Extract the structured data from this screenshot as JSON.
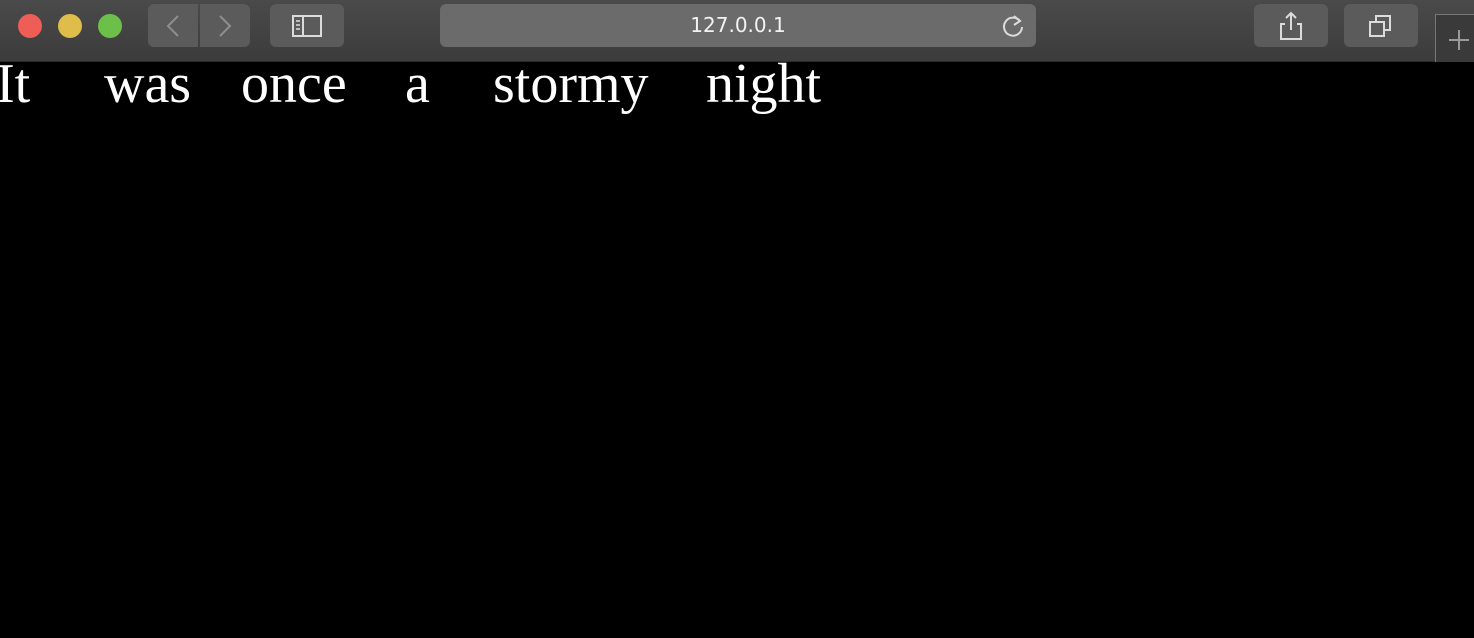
{
  "browser": {
    "address_bar": {
      "url": "127.0.0.1"
    },
    "icons": {
      "back": "chevron-left-icon",
      "forward": "chevron-right-icon",
      "sidebar": "sidebar-icon",
      "reload": "reload-icon",
      "share": "share-icon",
      "tabs": "tabs-overview-icon",
      "new_tab": "plus-icon"
    },
    "colors": {
      "close": "#ee5d56",
      "minimize": "#dfbd4b",
      "zoom": "#6cc04a",
      "toolbar": "#444444",
      "page_background": "#000000",
      "page_text": "#ffffff"
    }
  },
  "page": {
    "words": [
      "It",
      "was",
      "once",
      "a",
      "stormy",
      "night"
    ]
  }
}
